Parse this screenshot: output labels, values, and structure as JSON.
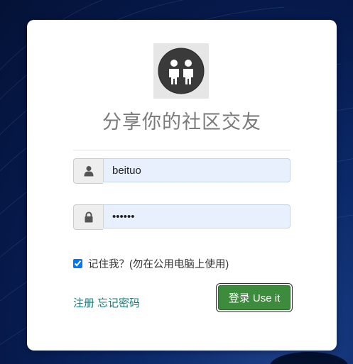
{
  "brand": {
    "title": "分享你的社区交友"
  },
  "login_form": {
    "username_value": "beituo",
    "password_value": "••••••",
    "remember_label": "记住我？(勿在公用电脑上使用)",
    "remember_checked": true,
    "register_link": "注册",
    "forgot_link": "忘记密码",
    "submit_label": "登录 Use it"
  },
  "icons": {
    "avatar": "people-icon",
    "username": "user-icon",
    "password": "lock-icon"
  },
  "colors": {
    "submit_button": "#3d8b3d",
    "link": "#1a7a7a",
    "input_fill": "#e8f0fe"
  }
}
